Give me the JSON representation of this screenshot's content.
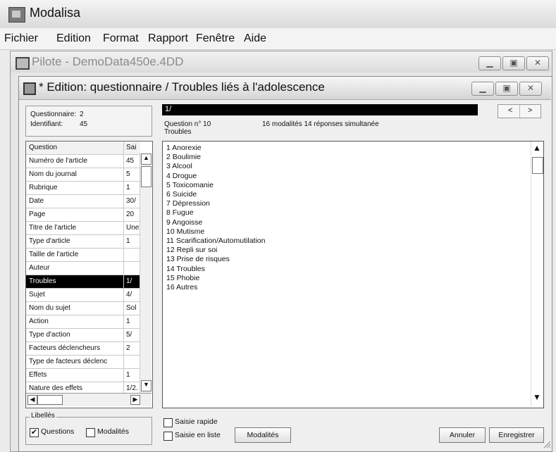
{
  "app": {
    "title": "Modalisa"
  },
  "menu": {
    "items": [
      "Fichier",
      "Edition",
      "Format",
      "Rapport",
      "Fenêtre",
      "Aide"
    ]
  },
  "pilote": {
    "title": "Pilote - DemoData450e.4DD"
  },
  "edition": {
    "title": "* Edition: questionnaire / Troubles liés à l'adolescence"
  },
  "window_buttons": {
    "minimize": "▁",
    "maximize": "▣",
    "close": "✕"
  },
  "info": {
    "questionnaire_label": "Questionnaire:",
    "questionnaire_value": "2",
    "identifiant_label": "Identifiant:",
    "identifiant_value": "45"
  },
  "grid": {
    "headers": [
      "Question",
      "Sai"
    ],
    "rows": [
      {
        "q": "Numéro de l'article",
        "v": "45"
      },
      {
        "q": "Nom du journal",
        "v": "5"
      },
      {
        "q": "Rubrique",
        "v": "1"
      },
      {
        "q": "Date",
        "v": "30/"
      },
      {
        "q": "Page",
        "v": "20"
      },
      {
        "q": "Titre de l'article",
        "v": "Une"
      },
      {
        "q": "Type d'article",
        "v": "1"
      },
      {
        "q": "Taille de l'article",
        "v": ""
      },
      {
        "q": "Auteur",
        "v": ""
      },
      {
        "q": "Troubles",
        "v": "1/"
      },
      {
        "q": "Sujet",
        "v": "4/"
      },
      {
        "q": "Nom du sujet",
        "v": "Sol"
      },
      {
        "q": "Action",
        "v": "1"
      },
      {
        "q": "Type d'action",
        "v": "5/"
      },
      {
        "q": "Facteurs déclencheurs",
        "v": "2"
      },
      {
        "q": "Type de facteurs déclenc",
        "v": ""
      },
      {
        "q": "Effets",
        "v": "1"
      },
      {
        "q": "Nature des effets",
        "v": "1/2."
      }
    ],
    "selected_index": 9
  },
  "answer": {
    "value": "1/"
  },
  "nav": {
    "prev": "<",
    "next": ">"
  },
  "question": {
    "number": "Question n° 10",
    "info": "16 modalités  14 réponses simultanée",
    "name": "Troubles"
  },
  "modalities": [
    "1  Anorexie",
    "2  Boulimie",
    "3  Alcool",
    "4  Drogue",
    "5  Toxicomanie",
    "6  Suicide",
    "7  Dépression",
    "8  Fugue",
    "9  Angoisse",
    "10  Mutisme",
    "11  Scarification/Automutilation",
    "12  Repli sur soi",
    "13  Prise de risques",
    "14  Troubles",
    "15  Phobie",
    "16  Autres"
  ],
  "bottom": {
    "libelles_title": "Libellés",
    "questions_label": "Questions",
    "questions_checked": true,
    "modalites_label": "Modalités",
    "modalites_checked": false,
    "saisie_rapide_label": "Saisie rapide",
    "saisie_rapide_checked": false,
    "saisie_liste_label": "Saisie en liste",
    "saisie_liste_checked": false,
    "modalites_button": "Modalités",
    "annuler_button": "Annuler",
    "enregistrer_button": "Enregistrer"
  }
}
